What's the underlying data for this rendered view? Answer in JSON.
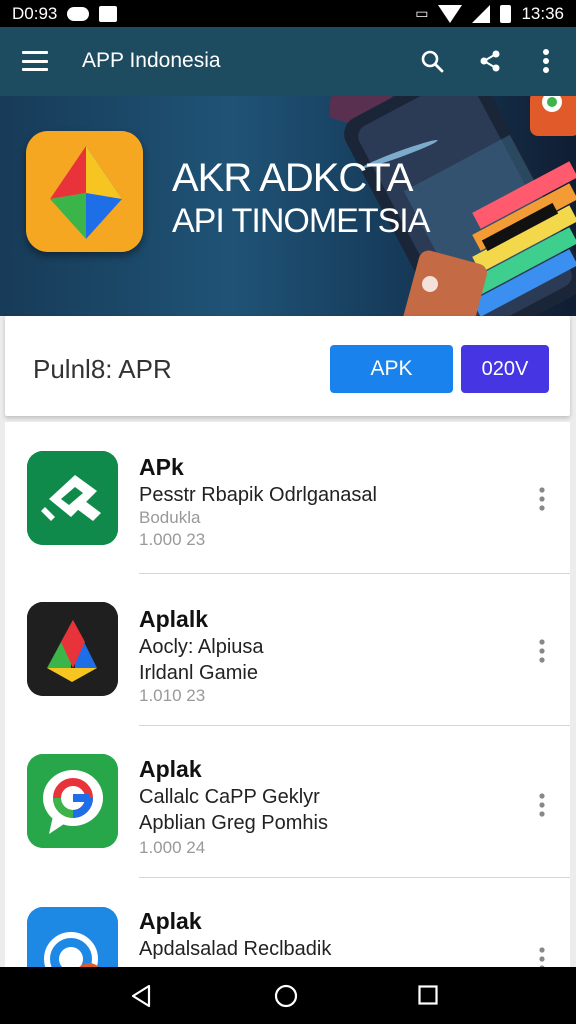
{
  "status_bar": {
    "time_left": "D0:93",
    "time_right": "13:36"
  },
  "app_bar": {
    "title": "APP Indonesia",
    "icons": [
      "menu-icon",
      "search-icon",
      "share-icon",
      "more-vert-icon"
    ]
  },
  "banner": {
    "title": "AKR ADKCTA",
    "subtitle": "API TINOMETSIA"
  },
  "filter": {
    "label": "Pulnl8: APR",
    "apk_button": "APK",
    "version_button": "020V"
  },
  "apps": [
    {
      "title": "APk",
      "line1": "Pesstr Rbapik Odrlganasal",
      "line2": "Bodukla",
      "meta": "1.000 23"
    },
    {
      "title": "Aplalk",
      "line1": "Aocly: Alpiusa",
      "line2": "Irldanl Gamie",
      "meta": "1.010 23"
    },
    {
      "title": "Aplak",
      "line1": "Callalc CaPP Geklyr",
      "line2": "Apblian Greg Pomhis",
      "meta": "1.000 24"
    },
    {
      "title": "Aplak",
      "line1": "Apdalsalad Reclbadik",
      "line2": "",
      "meta": ""
    }
  ],
  "colors": {
    "app_bar": "#1d4b60",
    "apk_button": "#1a82ec",
    "version_button": "#4635e2"
  }
}
